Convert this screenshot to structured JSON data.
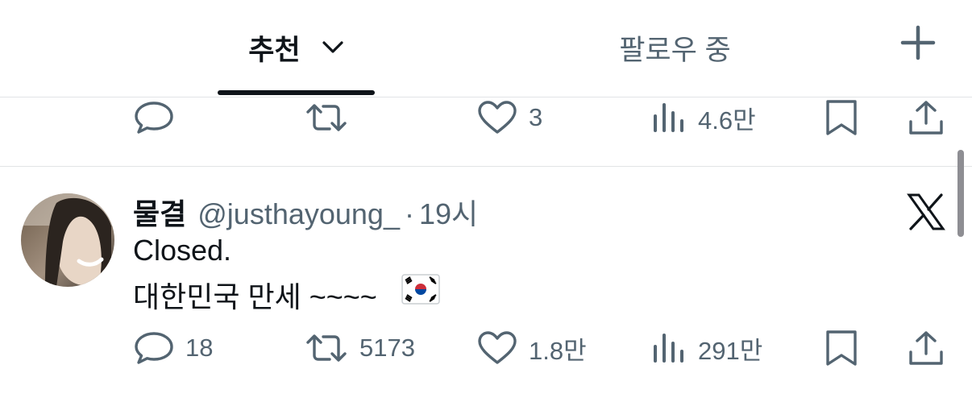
{
  "tabs": {
    "recommended": "추천",
    "following": "팔로우 중"
  },
  "top_post": {
    "actions": {
      "reply_count": "",
      "repost_count": "",
      "like_count": "3",
      "views_count": "4.6만"
    }
  },
  "post": {
    "author_name": "물결",
    "handle": "@justhayoung_",
    "separator": "·",
    "time": "19시",
    "text_line1": "Closed.",
    "text_line2": "대한민국 만세 ~~~~",
    "flag_emoji_name": "south-korea-flag",
    "actions": {
      "reply_count": "18",
      "repost_count": "5173",
      "like_count": "1.8만",
      "views_count": "291만"
    }
  },
  "icons": {
    "reply": "reply-icon",
    "repost": "repost-icon",
    "like": "heart-icon",
    "views": "views-icon",
    "bookmark": "bookmark-icon",
    "share": "share-icon",
    "source": "x-logo-icon",
    "add": "plus-icon",
    "tab_menu": "chevron-down-icon"
  },
  "colors": {
    "text": "#0f1419",
    "secondary": "#536471",
    "divider": "#e1e4e6",
    "background": "#ffffff"
  }
}
